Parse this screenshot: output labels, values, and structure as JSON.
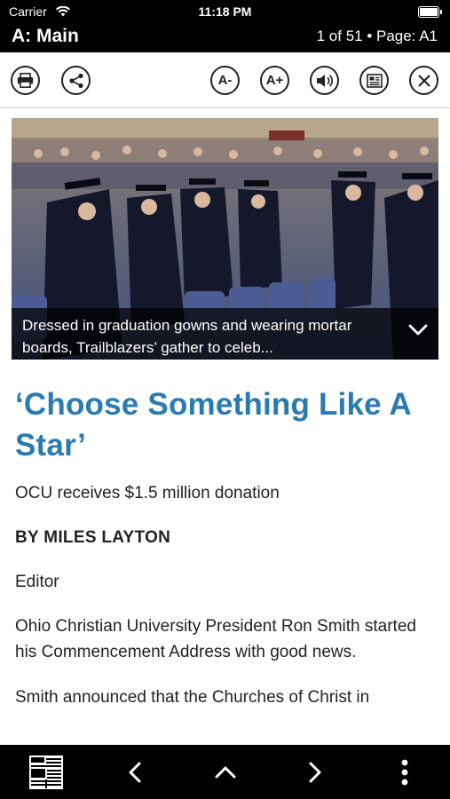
{
  "status_bar": {
    "carrier": "Carrier",
    "time": "11:18 PM"
  },
  "header": {
    "section": "A: Main",
    "page_info": "1 of 51 • Page: A1"
  },
  "toolbar": {
    "font_decrease_label": "A-",
    "font_increase_label": "A+"
  },
  "photo": {
    "caption": "Dressed in graduation gowns and wearing mortar boards, Trailblazers’ gather to celeb..."
  },
  "article": {
    "headline": "‘Choose Something Like A Star’",
    "subhead": "OCU receives $1.5 million donation",
    "byline": "BY MILES LAYTON",
    "role": "Editor",
    "paragraphs": [
      "Ohio Christian University President Ron Smith started his Commencement Address with good news.",
      "Smith announced that the Churches of Christ in"
    ]
  },
  "colors": {
    "headline": "#2a7bb0",
    "bars": "#000000"
  }
}
